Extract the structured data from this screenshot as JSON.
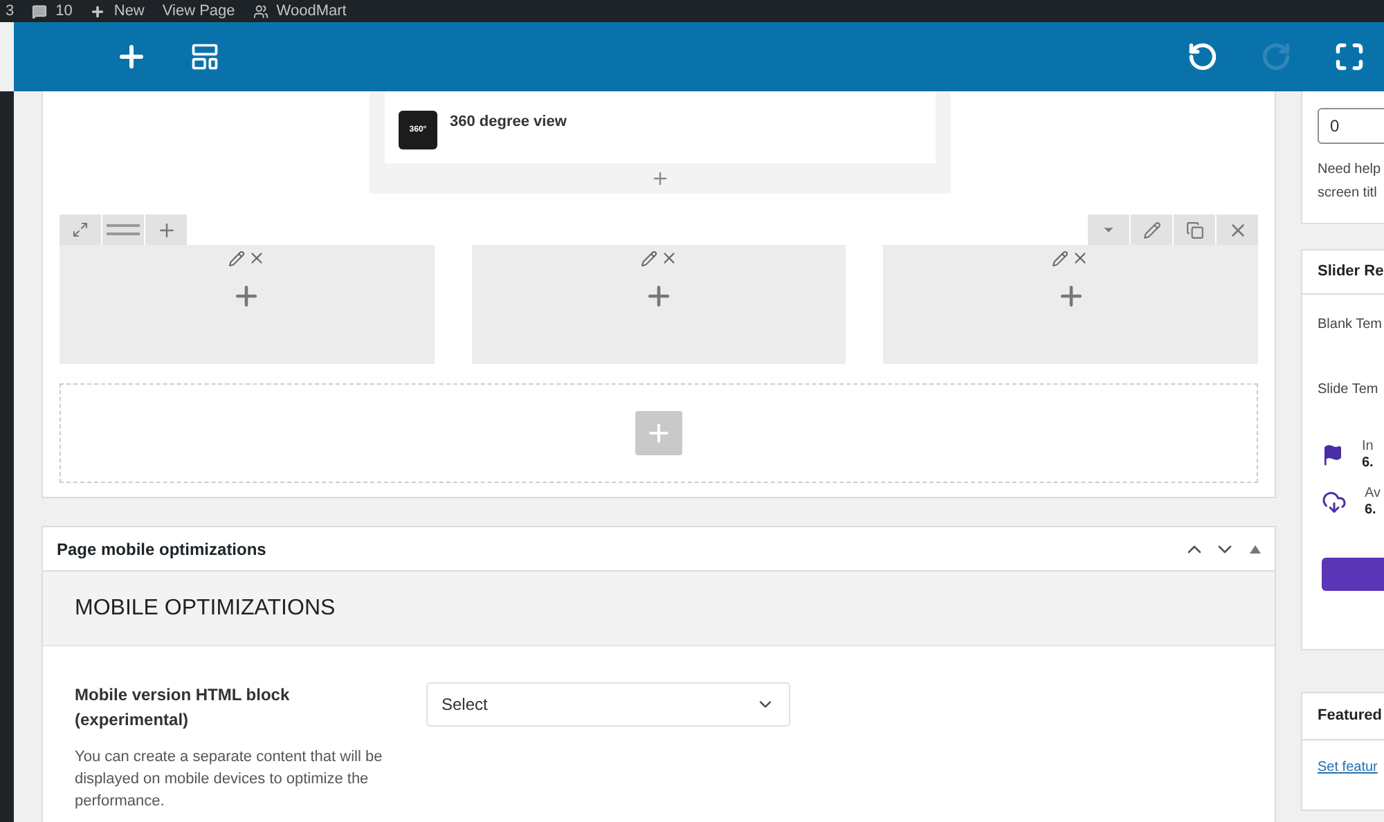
{
  "admin_bar": {
    "items": [
      {
        "kind": "count",
        "text": "3"
      },
      {
        "kind": "comments",
        "text": "10"
      },
      {
        "kind": "new",
        "text": "New"
      },
      {
        "kind": "link",
        "text": "View Page"
      },
      {
        "kind": "theme",
        "text": "WoodMart"
      }
    ]
  },
  "toolbar": {
    "redo_disabled": true
  },
  "builder": {
    "element": {
      "title": "360 degree view",
      "icon_text": "360°"
    }
  },
  "mobile_panel": {
    "title": "Page mobile optimizations",
    "section_title": "MOBILE OPTIMIZATIONS",
    "field": {
      "label": "Mobile version HTML block (experimental)",
      "value": "Select",
      "description": "You can create a separate content that will be displayed on mobile devices to optimize the performance."
    }
  },
  "sidebar": {
    "order_value": "0",
    "help_lines": [
      "Need help",
      "screen titl"
    ],
    "slider_box": {
      "title": "Slider Re",
      "rows": [
        "Blank Tem",
        "Slide Tem"
      ],
      "info": [
        {
          "kind": "flag",
          "label": "In",
          "version": "6."
        },
        {
          "kind": "cloud",
          "label": "Av",
          "version": "6."
        }
      ]
    },
    "featured_box": {
      "title": "Featured",
      "link": "Set featur"
    }
  }
}
